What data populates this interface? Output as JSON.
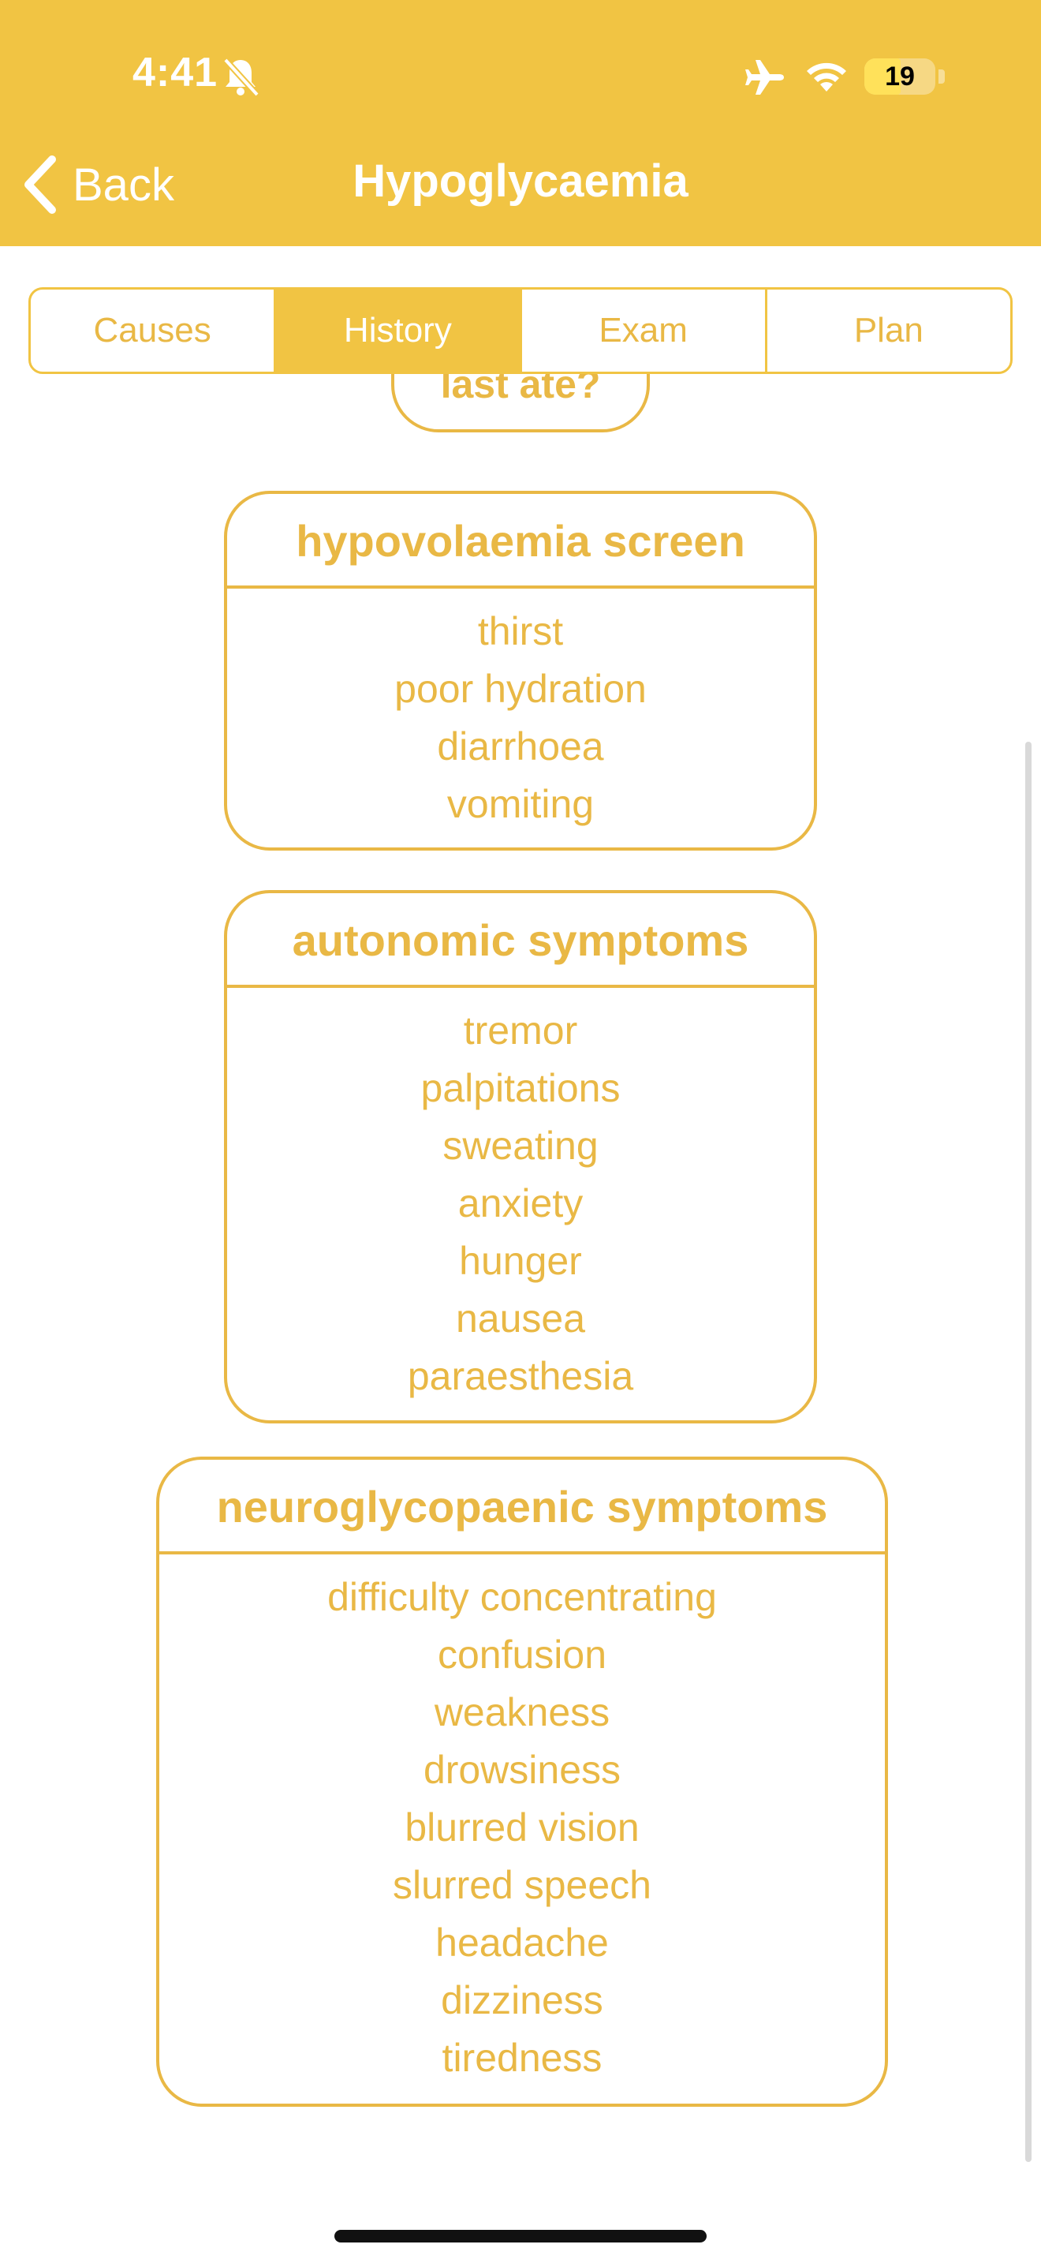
{
  "status_bar": {
    "time": "4:41",
    "battery": "19",
    "icons": [
      "bell-slash-icon",
      "airplane-icon",
      "wifi-icon",
      "battery-icon"
    ]
  },
  "nav": {
    "back_label": "Back",
    "title": "Hypoglycaemia"
  },
  "tabs": [
    {
      "label": "Causes",
      "active": false
    },
    {
      "label": "History",
      "active": true
    },
    {
      "label": "Exam",
      "active": false
    },
    {
      "label": "Plan",
      "active": false
    }
  ],
  "cards": {
    "previous_partial": "last ate?",
    "hypovolaemia": {
      "title": "hypovolaemia screen",
      "items": [
        "thirst",
        "poor hydration",
        "diarrhoea",
        "vomiting"
      ]
    },
    "autonomic": {
      "title": "autonomic symptoms",
      "items": [
        "tremor",
        "palpitations",
        "sweating",
        "anxiety",
        "hunger",
        "nausea",
        "paraesthesia"
      ]
    },
    "neuroglycopaenic": {
      "title": "neuroglycopaenic symptoms",
      "items": [
        "difficulty concentrating",
        "confusion",
        "weakness",
        "drowsiness",
        "blurred vision",
        "slurred speech",
        "headache",
        "dizziness",
        "tiredness"
      ]
    }
  },
  "colors": {
    "accent": "#F1C443",
    "card_text": "#E9B845"
  }
}
